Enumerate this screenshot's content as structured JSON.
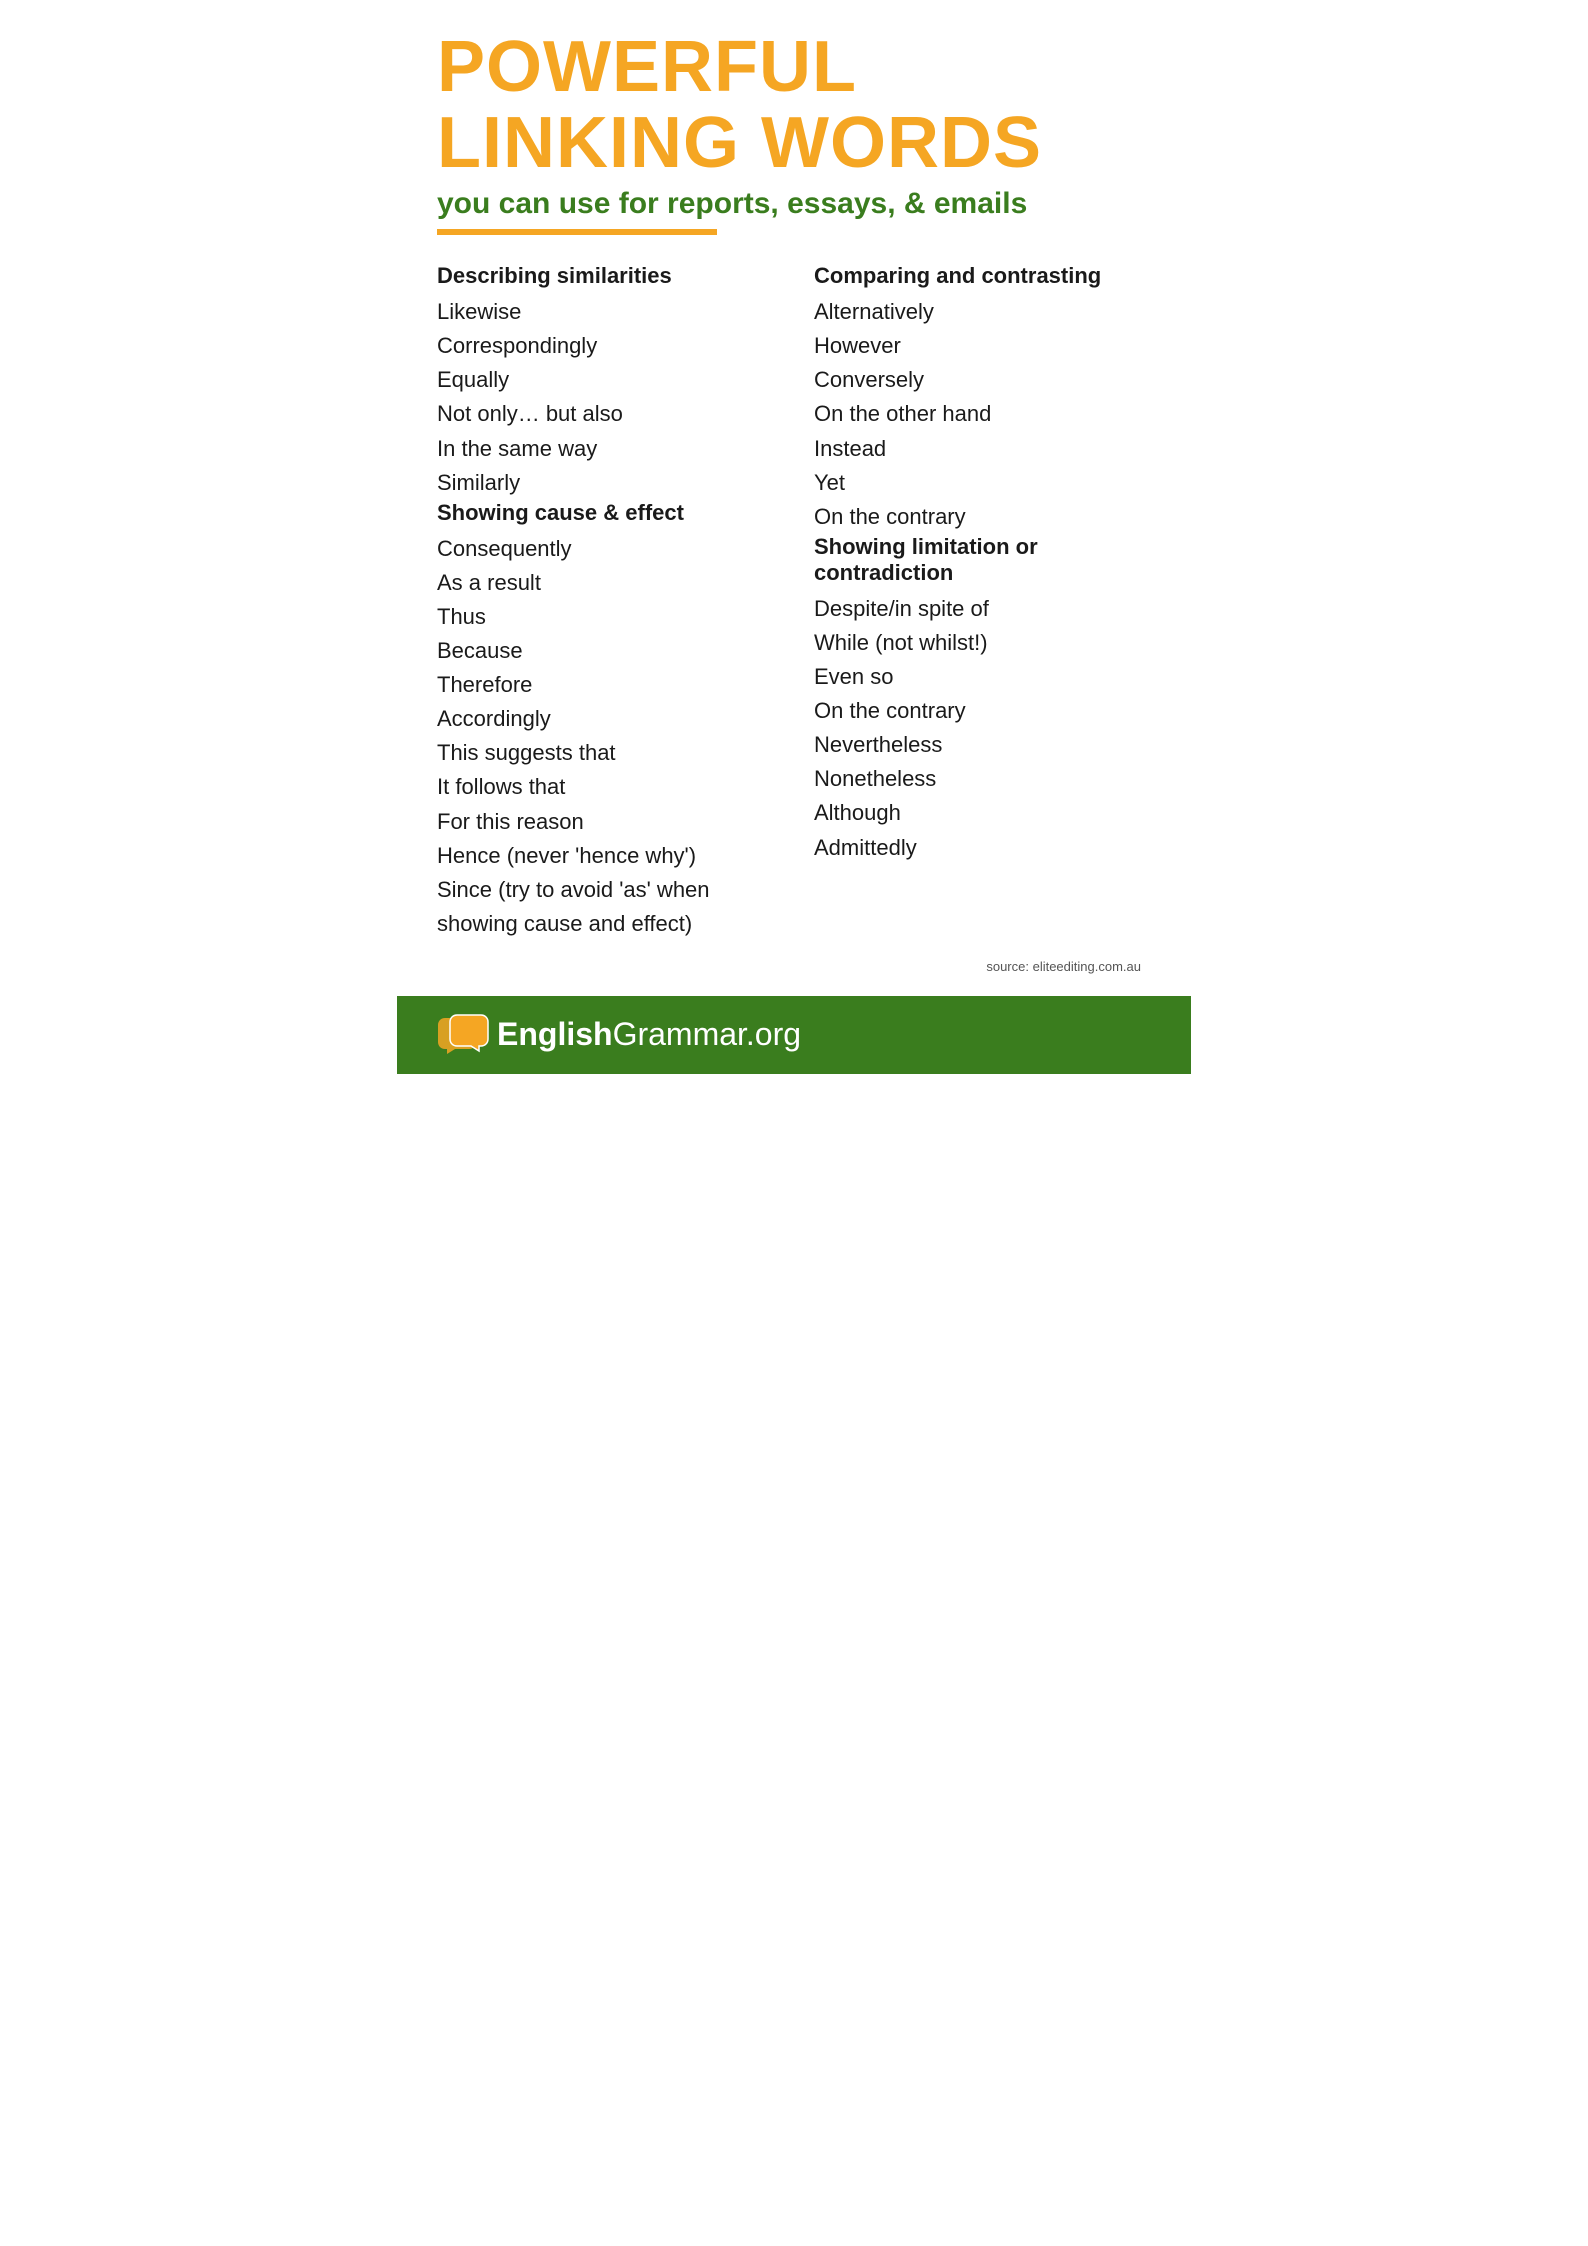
{
  "header": {
    "main_title": "POWERFUL LINKING WORDS",
    "subtitle": "you can use for reports, essays, & emails"
  },
  "left_column": {
    "section1": {
      "heading": "Describing similarities",
      "words": [
        "Likewise",
        "Correspondingly",
        "Equally",
        "Not only… but also",
        "In the same way",
        "Similarly"
      ]
    },
    "section2": {
      "heading": "Showing cause & effect",
      "words": [
        "Consequently",
        "As a result",
        "Thus",
        "Because",
        "Therefore",
        "Accordingly",
        "This suggests that",
        "It follows that",
        "For this reason",
        "Hence (never 'hence why')",
        "Since (try to avoid 'as' when showing cause and effect)"
      ]
    }
  },
  "right_column": {
    "section1": {
      "heading": "Comparing and contrasting",
      "words": [
        "Alternatively",
        "However",
        "Conversely",
        "On the other hand",
        "Instead",
        "Yet",
        "On the contrary"
      ]
    },
    "section2": {
      "heading": "Showing limitation or contradiction",
      "words": [
        "Despite/in spite of",
        "While (not whilst!)",
        "Even so",
        "On the contrary",
        "Nevertheless",
        "Nonetheless",
        "Although",
        "Admittedly"
      ]
    }
  },
  "source": "source: eliteediting.com.au",
  "footer": {
    "brand_english": "English",
    "brand_rest": "Grammar.org"
  }
}
